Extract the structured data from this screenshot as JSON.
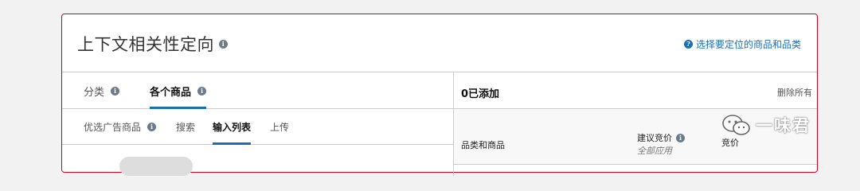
{
  "header": {
    "title": "上下文相关性定向",
    "choose_link": "选择要定位的商品和品类"
  },
  "tabs": [
    {
      "label": "分类",
      "active": false
    },
    {
      "label": "各个商品",
      "active": true
    }
  ],
  "subtabs": [
    {
      "label": "优选广告商品",
      "active": false
    },
    {
      "label": "搜索",
      "active": false
    },
    {
      "label": "输入列表",
      "active": true
    },
    {
      "label": "上传",
      "active": false
    }
  ],
  "added": {
    "count_label": "0已添加",
    "remove_all": "删除所有"
  },
  "columns": {
    "category": "品类和商品",
    "suggested_bid": "建议竞价",
    "apply_all": "全部应用",
    "bid": "竞价"
  },
  "watermark": {
    "text": "一味君"
  },
  "colors": {
    "accent": "#1a6fb5",
    "panel_border": "#d0021b"
  }
}
